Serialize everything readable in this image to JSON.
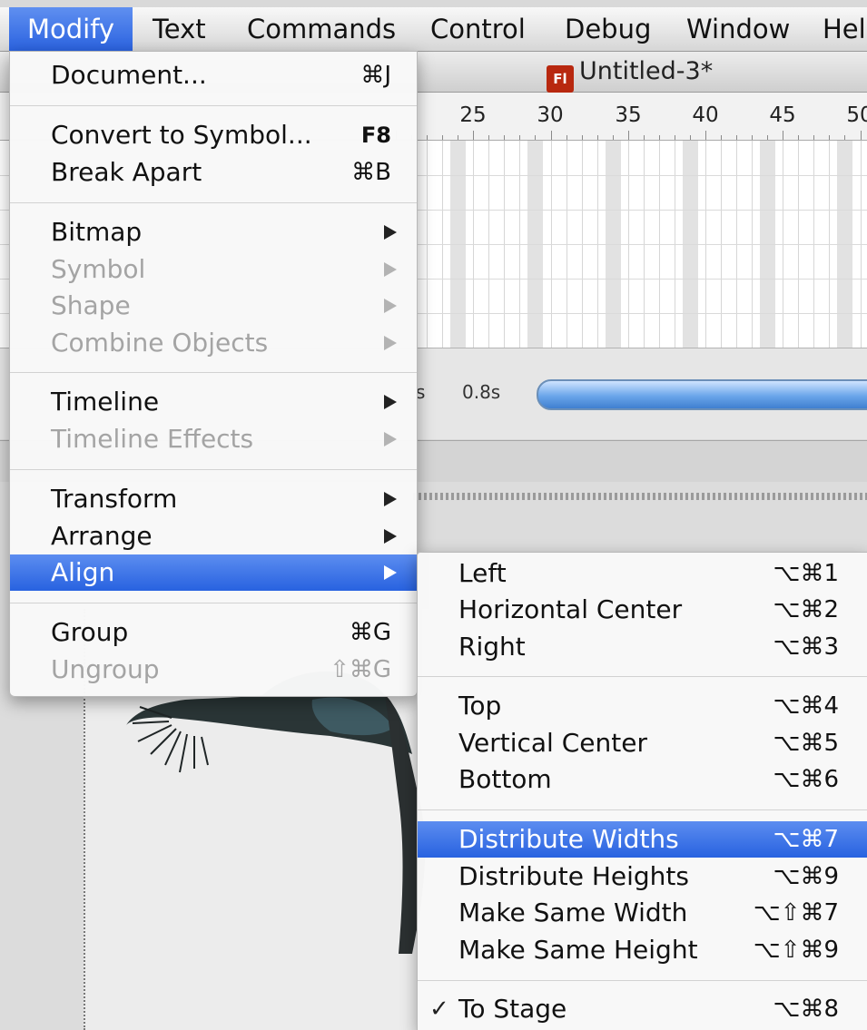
{
  "menubar": {
    "items": [
      "Modify",
      "Text",
      "Commands",
      "Control",
      "Debug",
      "Window",
      "Hel"
    ]
  },
  "document": {
    "title": "Untitled-3*",
    "app_icon": "Fl"
  },
  "timeline": {
    "ruler_labels": [
      "25",
      "30",
      "35",
      "40",
      "45",
      "50"
    ],
    "time_partial": "s",
    "time_elapsed": "0.8s"
  },
  "modify_menu": {
    "items": [
      {
        "label": "Document...",
        "shortcut": "⌘J",
        "enabled": true
      },
      {
        "label": "Convert to Symbol...",
        "shortcut": "F8",
        "enabled": true
      },
      {
        "label": "Break Apart",
        "shortcut": "⌘B",
        "enabled": true
      },
      {
        "label": "Bitmap",
        "submenu": true,
        "enabled": true
      },
      {
        "label": "Symbol",
        "submenu": true,
        "enabled": false
      },
      {
        "label": "Shape",
        "submenu": true,
        "enabled": false
      },
      {
        "label": "Combine Objects",
        "submenu": true,
        "enabled": false
      },
      {
        "label": "Timeline",
        "submenu": true,
        "enabled": true
      },
      {
        "label": "Timeline Effects",
        "submenu": true,
        "enabled": false
      },
      {
        "label": "Transform",
        "submenu": true,
        "enabled": true
      },
      {
        "label": "Arrange",
        "submenu": true,
        "enabled": true
      },
      {
        "label": "Align",
        "submenu": true,
        "enabled": true,
        "highlighted": true
      },
      {
        "label": "Group",
        "shortcut": "⌘G",
        "enabled": true
      },
      {
        "label": "Ungroup",
        "shortcut": "⇧⌘G",
        "enabled": false
      }
    ]
  },
  "align_submenu": {
    "items": [
      {
        "label": "Left",
        "shortcut": "⌥⌘1"
      },
      {
        "label": "Horizontal Center",
        "shortcut": "⌥⌘2"
      },
      {
        "label": "Right",
        "shortcut": "⌥⌘3"
      },
      {
        "label": "Top",
        "shortcut": "⌥⌘4"
      },
      {
        "label": "Vertical Center",
        "shortcut": "⌥⌘5"
      },
      {
        "label": "Bottom",
        "shortcut": "⌥⌘6"
      },
      {
        "label": "Distribute Widths",
        "shortcut": "⌥⌘7",
        "highlighted": true
      },
      {
        "label": "Distribute Heights",
        "shortcut": "⌥⌘9"
      },
      {
        "label": "Make Same Width",
        "shortcut": "⌥⇧⌘7"
      },
      {
        "label": "Make Same Height",
        "shortcut": "⌥⇧⌘9"
      },
      {
        "label": "To Stage",
        "shortcut": "⌥⌘8",
        "checked": true
      }
    ]
  },
  "colors": {
    "highlight": "#2b63e0",
    "disabled_text": "#a4a4a4",
    "app_icon": "#b8280f"
  }
}
